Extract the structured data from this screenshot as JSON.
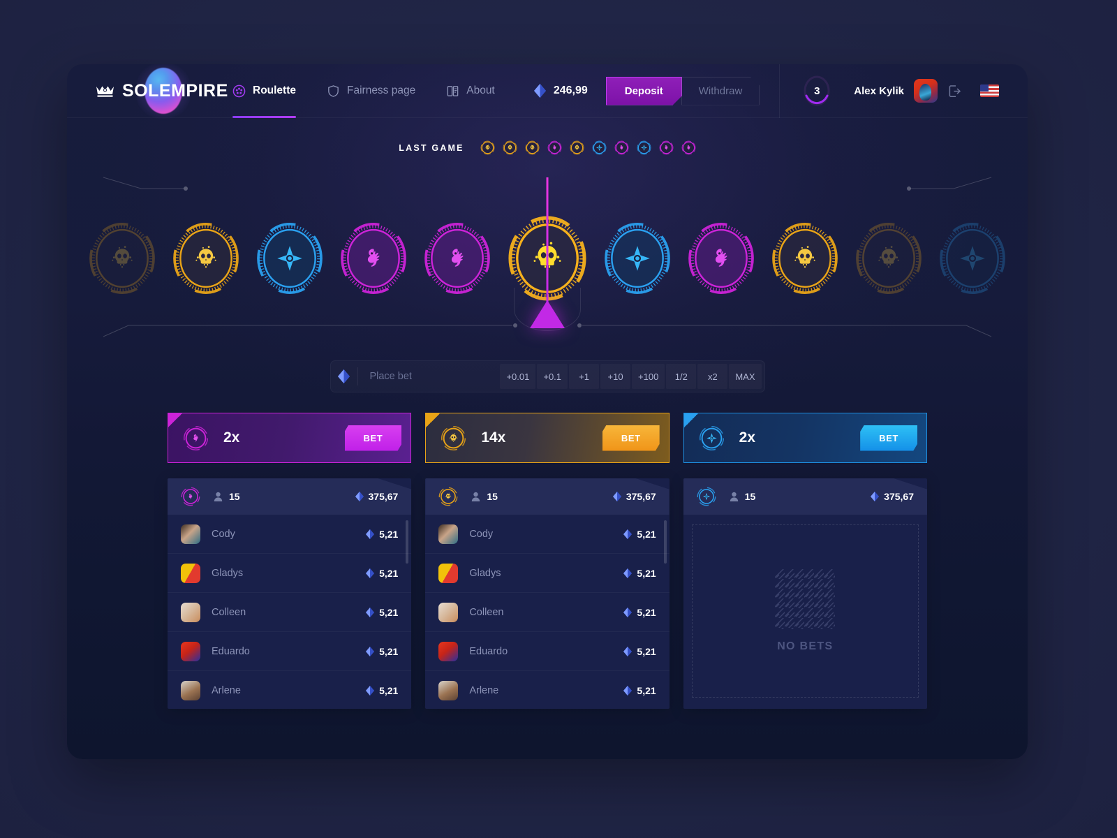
{
  "brand": {
    "name": "SOLEMPIRE",
    "icon": "crown-icon"
  },
  "nav": [
    {
      "label": "Roulette",
      "icon": "roulette-icon",
      "active": true
    },
    {
      "label": "Fairness page",
      "icon": "shield-icon",
      "active": false
    },
    {
      "label": "About",
      "icon": "book-icon",
      "active": false
    }
  ],
  "header": {
    "balance": "246,99",
    "balance_icon": "gem-icon",
    "deposit_label": "Deposit",
    "withdraw_label": "Withdraw",
    "level": "3",
    "user_name": "Alex Kylik",
    "avatar_icon": "avatar",
    "logout_icon": "logout-icon",
    "flag_icon": "us-flag-icon"
  },
  "last_game": {
    "label": "LAST GAME",
    "results": [
      "gold",
      "gold",
      "gold",
      "purple",
      "gold",
      "blue",
      "purple",
      "blue",
      "purple",
      "purple"
    ]
  },
  "wheel": {
    "slots": [
      {
        "type": "skull",
        "color": "gold",
        "state": "dim"
      },
      {
        "type": "skull",
        "color": "gold",
        "state": "normal"
      },
      {
        "type": "compass",
        "color": "blue",
        "state": "normal"
      },
      {
        "type": "phoenix",
        "color": "purple",
        "state": "normal"
      },
      {
        "type": "phoenix",
        "color": "purple",
        "state": "normal"
      },
      {
        "type": "skull",
        "color": "gold",
        "state": "selected"
      },
      {
        "type": "compass",
        "color": "blue",
        "state": "normal"
      },
      {
        "type": "phoenix",
        "color": "purple",
        "state": "normal"
      },
      {
        "type": "skull",
        "color": "gold",
        "state": "normal"
      },
      {
        "type": "skull",
        "color": "gold",
        "state": "dim"
      },
      {
        "type": "compass",
        "color": "blue",
        "state": "dim"
      }
    ],
    "pointer_icon": "pointer-triangle"
  },
  "bet_bar": {
    "currency_icon": "gem-icon",
    "placeholder": "Place bet",
    "value": "",
    "chips": [
      "+0.01",
      "+0.1",
      "+1",
      "+10",
      "+100",
      "1/2",
      "x2",
      "MAX"
    ]
  },
  "multiplier_cards": [
    {
      "icon": "phoenix-icon",
      "multiplier": "2x",
      "bet_label": "BET",
      "theme": "purple"
    },
    {
      "icon": "skull-icon",
      "multiplier": "14x",
      "bet_label": "BET",
      "theme": "gold"
    },
    {
      "icon": "compass-icon",
      "multiplier": "2x",
      "bet_label": "BET",
      "theme": "blue"
    }
  ],
  "bet_lists": [
    {
      "theme": "purple",
      "icon": "phoenix-icon",
      "players_icon": "person-icon",
      "players": "15",
      "total": "375,67",
      "total_icon": "gem-icon",
      "empty": false,
      "rows": [
        {
          "name": "Cody",
          "amount": "5,21"
        },
        {
          "name": "Gladys",
          "amount": "5,21"
        },
        {
          "name": "Colleen",
          "amount": "5,21"
        },
        {
          "name": "Eduardo",
          "amount": "5,21"
        },
        {
          "name": "Arlene",
          "amount": "5,21"
        }
      ]
    },
    {
      "theme": "gold",
      "icon": "skull-icon",
      "players_icon": "person-icon",
      "players": "15",
      "total": "375,67",
      "total_icon": "gem-icon",
      "empty": false,
      "rows": [
        {
          "name": "Cody",
          "amount": "5,21"
        },
        {
          "name": "Gladys",
          "amount": "5,21"
        },
        {
          "name": "Colleen",
          "amount": "5,21"
        },
        {
          "name": "Eduardo",
          "amount": "5,21"
        },
        {
          "name": "Arlene",
          "amount": "5,21"
        }
      ]
    },
    {
      "theme": "blue",
      "icon": "compass-icon",
      "players_icon": "person-icon",
      "players": "15",
      "total": "375,67",
      "total_icon": "gem-icon",
      "empty": true,
      "empty_label": "NO BETS",
      "empty_icon": "hatch-pattern-icon",
      "rows": []
    }
  ],
  "colors": {
    "purple": "#cc23d8",
    "gold": "#e8a317",
    "blue": "#2aa0ef",
    "accent": "#8b3cf5",
    "panel": "#19204a",
    "panel_head": "#252c58",
    "app_bg": "#161b3b",
    "page_bg": "#222749"
  }
}
